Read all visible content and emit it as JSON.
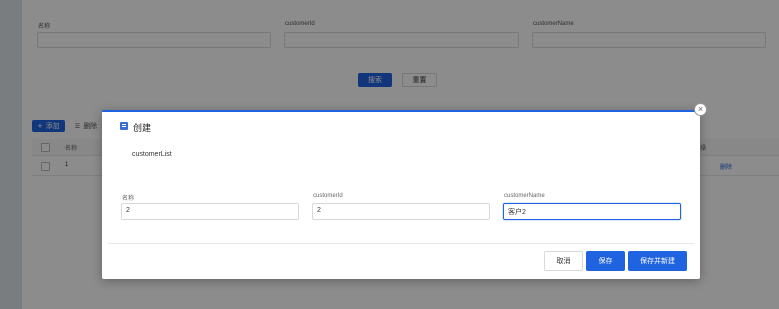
{
  "search": {
    "fields": [
      {
        "label": "名称"
      },
      {
        "label": "customerId"
      },
      {
        "label": "customerName"
      }
    ],
    "search_label": "搜索",
    "reset_label": "重置"
  },
  "toolbar": {
    "add_label": "添加",
    "delete_label": "删除"
  },
  "table": {
    "headers": [
      "名称",
      "操"
    ],
    "rows": [
      {
        "name": "1",
        "action": "删除"
      }
    ]
  },
  "modal": {
    "title": "创建",
    "subtitle": "customerList",
    "fields": [
      {
        "label": "名称",
        "value": "2"
      },
      {
        "label": "customerId",
        "value": "2"
      },
      {
        "label": "customerName",
        "value": "客户2"
      }
    ],
    "cancel_label": "取消",
    "save_label": "保存",
    "save_new_label": "保存并新建"
  },
  "colors": {
    "primary": "#1f63e0",
    "border": "#d9d9d9"
  }
}
